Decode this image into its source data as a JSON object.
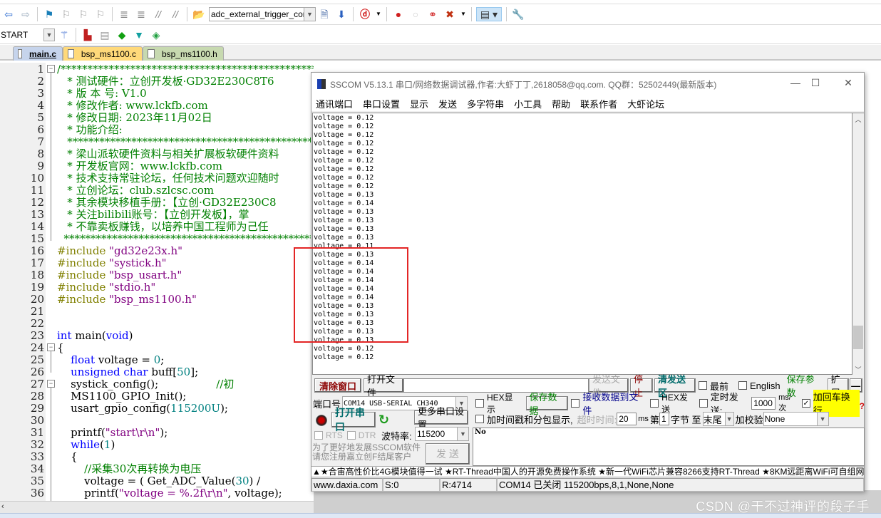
{
  "ide": {
    "toolbar1": {
      "icons": [
        "back-arrow-icon",
        "forward-arrow-icon",
        "bookmark-flag-icon",
        "prev-bookmark-icon",
        "next-bookmark-icon",
        "clear-bookmarks-icon",
        "indent-icon",
        "unindent-icon",
        "comment-icon",
        "uncomment-icon",
        "open-file-icon"
      ],
      "target_combo": "adc_external_trigger_con",
      "icons2": [
        "find-in-files-icon",
        "incremental-find-icon",
        "debug-icon",
        "breakpoint-icon",
        "breakpoint-disabled-icon",
        "disable-all-breakpoints-icon",
        "kill-breakpoints-icon",
        "window-layout-icon",
        "settings-wrench-icon"
      ]
    },
    "toolbar2": {
      "target_select": "START",
      "icons": [
        "magic-wand-icon",
        "pack-installer-icon",
        "manage-components-icon",
        "select-device-icon",
        "event-recorder-icon",
        "run-time-env-icon"
      ]
    },
    "tabs": [
      {
        "label": "main.c",
        "active": true
      },
      {
        "label": "bsp_ms1100.c",
        "active": false
      },
      {
        "label": "bsp_ms1100.h",
        "active": false
      }
    ],
    "code": [
      {
        "n": "1",
        "parts": [
          [
            "cm",
            "/*********************************************************************************"
          ]
        ]
      },
      {
        "n": "2",
        "parts": [
          [
            "cm",
            "   * 测试硬件：立创开发板·GD32E230C8T6"
          ]
        ]
      },
      {
        "n": "3",
        "parts": [
          [
            "cm",
            "   * 版 本 号: V1.0"
          ]
        ]
      },
      {
        "n": "4",
        "parts": [
          [
            "cm",
            "   * 修改作者: www.lckfb.com"
          ]
        ]
      },
      {
        "n": "5",
        "parts": [
          [
            "cm",
            "   * 修改日期: 2023年11月02日"
          ]
        ]
      },
      {
        "n": "6",
        "parts": [
          [
            "cm",
            "   * 功能介绍:"
          ]
        ]
      },
      {
        "n": "7",
        "parts": [
          [
            "cm",
            "   ***********************************************************************"
          ]
        ]
      },
      {
        "n": "8",
        "parts": [
          [
            "cm",
            "   * 梁山派软硬件资料与相关扩展板软硬件资料"
          ]
        ]
      },
      {
        "n": "9",
        "parts": [
          [
            "cm",
            "   * 开发板官网：www.lckfb.com"
          ]
        ]
      },
      {
        "n": "10",
        "parts": [
          [
            "cm",
            "   * 技术支持常驻论坛，任何技术问题欢迎随时"
          ]
        ]
      },
      {
        "n": "11",
        "parts": [
          [
            "cm",
            "   * 立创论坛：club.szlcsc.com"
          ]
        ]
      },
      {
        "n": "12",
        "parts": [
          [
            "cm",
            "   * 其余模块移植手册：【立创·GD32E230C8"
          ]
        ]
      },
      {
        "n": "13",
        "parts": [
          [
            "cm",
            "   * 关注bilibili账号：【立创开发板】，掌"
          ]
        ]
      },
      {
        "n": "14",
        "parts": [
          [
            "cm",
            "   * 不靠卖板赚钱，以培养中国工程师为己任"
          ]
        ]
      },
      {
        "n": "15",
        "parts": [
          [
            "cm",
            "  ***********************************************************************"
          ]
        ]
      },
      {
        "n": "16",
        "parts": [
          [
            "pp",
            "#include "
          ],
          [
            "st",
            "\"gd32e23x.h\""
          ]
        ]
      },
      {
        "n": "17",
        "parts": [
          [
            "pp",
            "#include "
          ],
          [
            "st",
            "\"systick.h\""
          ]
        ]
      },
      {
        "n": "18",
        "parts": [
          [
            "pp",
            "#include "
          ],
          [
            "st",
            "\"bsp_usart.h\""
          ]
        ]
      },
      {
        "n": "19",
        "parts": [
          [
            "pp",
            "#include "
          ],
          [
            "st",
            "\"stdio.h\""
          ]
        ]
      },
      {
        "n": "20",
        "parts": [
          [
            "pp",
            "#include "
          ],
          [
            "st",
            "\"bsp_ms1100.h\""
          ]
        ]
      },
      {
        "n": "21",
        "parts": []
      },
      {
        "n": "22",
        "parts": []
      },
      {
        "n": "23",
        "parts": [
          [
            "kw",
            "int"
          ],
          [
            "df",
            " main("
          ],
          [
            "kw",
            "void"
          ],
          [
            "df",
            ")"
          ]
        ]
      },
      {
        "n": "24",
        "parts": [
          [
            "df",
            "{"
          ]
        ]
      },
      {
        "n": "25",
        "parts": [
          [
            "df",
            "    "
          ],
          [
            "kw",
            "float"
          ],
          [
            "df",
            " voltage = "
          ],
          [
            "nm",
            "0"
          ],
          [
            "df",
            ";"
          ]
        ]
      },
      {
        "n": "26",
        "parts": [
          [
            "df",
            "    "
          ],
          [
            "kw",
            "unsigned char"
          ],
          [
            "df",
            " buff["
          ],
          [
            "nm",
            "50"
          ],
          [
            "df",
            "];"
          ]
        ]
      },
      {
        "n": "27",
        "parts": [
          [
            "df",
            "    systick_config();                 "
          ],
          [
            "cm",
            "//初"
          ]
        ]
      },
      {
        "n": "28",
        "parts": [
          [
            "df",
            "    MS1100_GPIO_Init();"
          ]
        ]
      },
      {
        "n": "29",
        "parts": [
          [
            "df",
            "    usart_gpio_config("
          ],
          [
            "nm",
            "115200U"
          ],
          [
            "df",
            ");"
          ]
        ]
      },
      {
        "n": "30",
        "parts": []
      },
      {
        "n": "31",
        "parts": [
          [
            "df",
            "    printf("
          ],
          [
            "st",
            "\"start\\r\\n\""
          ],
          [
            "df",
            ");"
          ]
        ]
      },
      {
        "n": "32",
        "parts": [
          [
            "df",
            "    "
          ],
          [
            "kw",
            "while"
          ],
          [
            "df",
            "("
          ],
          [
            "nm",
            "1"
          ],
          [
            "df",
            ")"
          ]
        ]
      },
      {
        "n": "33",
        "parts": [
          [
            "df",
            "    {"
          ]
        ]
      },
      {
        "n": "34",
        "parts": [
          [
            "df",
            "        "
          ],
          [
            "cm",
            "//采集30次再转换为电压"
          ]
        ]
      },
      {
        "n": "35",
        "parts": [
          [
            "df",
            "        voltage = ( Get_ADC_Value("
          ],
          [
            "nm",
            "30"
          ],
          [
            "df",
            ") / "
          ]
        ]
      },
      {
        "n": "36",
        "parts": [
          [
            "df",
            "        printf("
          ],
          [
            "st",
            "\"voltage = %.2f\\r\\n\""
          ],
          [
            "df",
            ", voltage);"
          ]
        ]
      }
    ]
  },
  "sscom": {
    "title": "SSCOM V5.13.1 串口/网络数据调试器,作者:大虾丁丁,2618058@qq.com. QQ群：52502449(最新版本)",
    "window_buttons": {
      "minimize": "—",
      "maximize": "☐",
      "close": "✕"
    },
    "menu": [
      "通讯端口",
      "串口设置",
      "显示",
      "发送",
      "多字符串",
      "小工具",
      "帮助",
      "联系作者",
      "大虾论坛"
    ],
    "receive_lines": [
      "voltage = 0.12",
      "voltage = 0.12",
      "voltage = 0.12",
      "voltage = 0.12",
      "voltage = 0.12",
      "voltage = 0.12",
      "voltage = 0.12",
      "voltage = 0.12",
      "voltage = 0.12",
      "voltage = 0.13",
      "voltage = 0.14",
      "voltage = 0.13",
      "voltage = 0.13",
      "voltage = 0.13",
      "voltage = 0.13",
      "voltage = 0.11",
      "voltage = 0.13",
      "voltage = 0.14",
      "voltage = 0.14",
      "voltage = 0.14",
      "voltage = 0.14",
      "voltage = 0.14",
      "voltage = 0.13",
      "voltage = 0.13",
      "voltage = 0.13",
      "voltage = 0.13",
      "voltage = 0.13",
      "voltage = 0.12",
      "voltage = 0.12"
    ],
    "scroll_position": 0.93,
    "row1": {
      "clear_btn": "清除窗口",
      "open_file_btn": "打开文件",
      "file_path": "",
      "send_file_btn": "发送文件",
      "stop_btn": "停止",
      "clear_send_btn": "清发送区",
      "topmost_label": "最前",
      "english_label": "English",
      "save_params_btn": "保存参数",
      "expand_btn": "扩展",
      "collapse_btn": "—"
    },
    "port": {
      "port_label": "端口号",
      "port_value": "COM14 USB-SERIAL CH340",
      "open_port_btn": "打开串口",
      "more_settings_btn": "更多串口设置",
      "rts_label": "RTS",
      "dtr_label": "DTR",
      "baud_label": "波特率:",
      "baud_value": "115200",
      "promo_line1": "为了更好地发展SSCOM软件",
      "promo_line2": "请您注册嘉立创F结尾客户",
      "send_btn": "发 送"
    },
    "options": {
      "hex_display": "HEX显示",
      "save_data_btn": "保存数据",
      "recv_to_file": "接收数据到文件",
      "hex_send": "HEX发送",
      "timed_send": "定时发送:",
      "interval": "1000",
      "interval_unit": "ms/次",
      "add_crlf": "加回车换行",
      "add_crlf_checked": true,
      "timestamp": "加时间戳和分包显示,",
      "timeout_label": "超时时间:",
      "timeout_value": "20",
      "timeout_unit": "ms",
      "byte_label_1": "第",
      "byte_from": "1",
      "byte_label_2": "字节 至",
      "byte_to": "末尾",
      "checksum_label": "加校验",
      "checksum_value": "None",
      "send_text": "No",
      "help_mark": "?"
    },
    "notice": "▲★合宙高性价比4G模块值得一试 ★RT-Thread中国人的开源免费操作系统 ★新一代WiFi芯片兼容8266支持RT-Thread ★8KM远距离WiFi可自组网",
    "status": {
      "site": "www.daxia.com",
      "sent": "S:0",
      "received": "R:4714",
      "port_status": "COM14 已关闭  115200bps,8,1,None,None"
    }
  },
  "watermark": "CSDN @干不过神评的段子手",
  "colors": {
    "comment": "#008000",
    "keyword": "#0000ff",
    "string": "#800080",
    "preproc": "#808000",
    "number": "#008080",
    "highlight_box": "#e32525",
    "crlf_bg": "#ffff00"
  }
}
